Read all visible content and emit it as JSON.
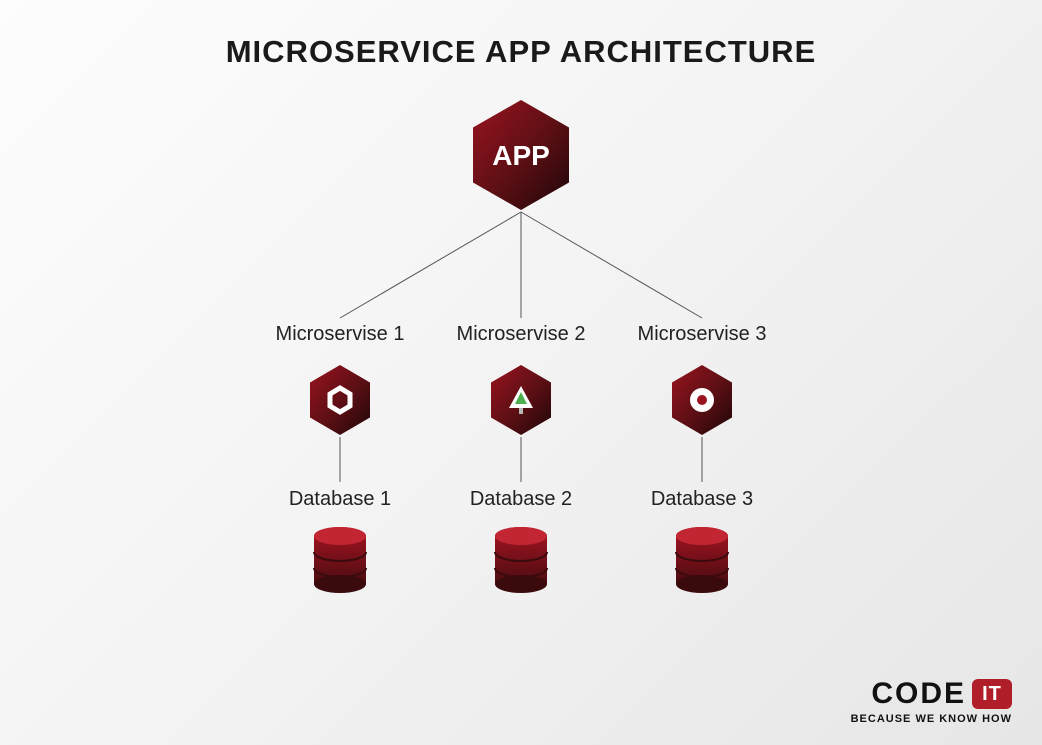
{
  "title": "MICROSERVICE APP ARCHITECTURE",
  "app_label": "APP",
  "microservices": [
    {
      "label": "Microservise 1",
      "db_label": "Database 1",
      "icon": "hexagon-outline-icon"
    },
    {
      "label": "Microservise 2",
      "db_label": "Database 2",
      "icon": "tree-icon"
    },
    {
      "label": "Microservise 3",
      "db_label": "Database 3",
      "icon": "ring-icon"
    }
  ],
  "logo": {
    "code": "CODE",
    "it": "IT",
    "tagline": "BECAUSE WE KNOW HOW"
  },
  "colors": {
    "hex_grad_a": "#8a0f1a",
    "hex_grad_b": "#2a0a0d",
    "db_top": "#b01e2a",
    "db_side": "#6f0f17",
    "line": "#555"
  }
}
